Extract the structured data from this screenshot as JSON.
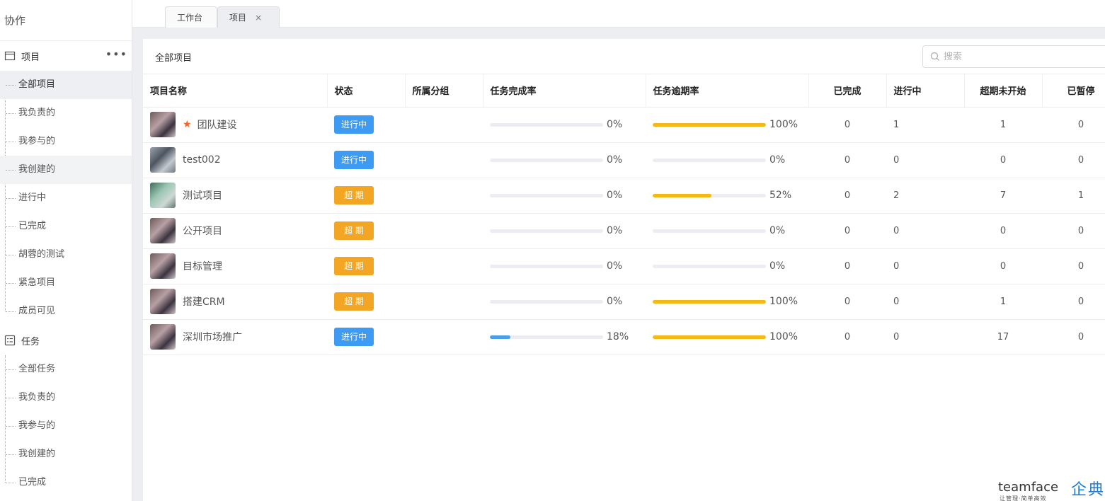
{
  "sidebar": {
    "title": "协作",
    "project_section": {
      "label": "项目",
      "more": "•••",
      "items": [
        "全部项目",
        "我负责的",
        "我参与的",
        "我创建的",
        "进行中",
        "已完成",
        "胡蓉的测试",
        "紧急项目",
        "成员可见"
      ]
    },
    "task_section": {
      "label": "任务",
      "items": [
        "全部任务",
        "我负责的",
        "我参与的",
        "我创建的",
        "已完成"
      ]
    }
  },
  "tabs": [
    {
      "label": "工作台"
    },
    {
      "label": "项目",
      "close": "×"
    }
  ],
  "panel": {
    "title": "全部项目",
    "search_placeholder": "搜索"
  },
  "table": {
    "headers": [
      "项目名称",
      "状态",
      "所属分组",
      "任务完成率",
      "任务逾期率",
      "已完成",
      "进行中",
      "超期未开始",
      "已暂停"
    ],
    "rows": [
      {
        "name": "团队建设",
        "starred": true,
        "status": "进行中",
        "status_color": "#3d9bf4",
        "group": "",
        "completion": 0,
        "completion_text": "0%",
        "overdue": 100,
        "overdue_text": "100%",
        "done": "0",
        "ongoing": "1",
        "overdue_not_started": "1",
        "paused": "0"
      },
      {
        "name": "test002",
        "starred": false,
        "status": "进行中",
        "status_color": "#3d9bf4",
        "group": "",
        "completion": 0,
        "completion_text": "0%",
        "overdue": 0,
        "overdue_text": "0%",
        "done": "0",
        "ongoing": "0",
        "overdue_not_started": "0",
        "paused": "0"
      },
      {
        "name": "测试项目",
        "starred": false,
        "status": "超 期",
        "status_color": "#f3a623",
        "group": "",
        "completion": 0,
        "completion_text": "0%",
        "overdue": 52,
        "overdue_text": "52%",
        "done": "0",
        "ongoing": "2",
        "overdue_not_started": "7",
        "paused": "1"
      },
      {
        "name": "公开项目",
        "starred": false,
        "status": "超 期",
        "status_color": "#f3a623",
        "group": "",
        "completion": 0,
        "completion_text": "0%",
        "overdue": 0,
        "overdue_text": "0%",
        "done": "0",
        "ongoing": "0",
        "overdue_not_started": "0",
        "paused": "0"
      },
      {
        "name": "目标管理",
        "starred": false,
        "status": "超 期",
        "status_color": "#f3a623",
        "group": "",
        "completion": 0,
        "completion_text": "0%",
        "overdue": 0,
        "overdue_text": "0%",
        "done": "0",
        "ongoing": "0",
        "overdue_not_started": "0",
        "paused": "0"
      },
      {
        "name": "搭建CRM",
        "starred": false,
        "status": "超 期",
        "status_color": "#f3a623",
        "group": "",
        "completion": 0,
        "completion_text": "0%",
        "overdue": 100,
        "overdue_text": "100%",
        "done": "0",
        "ongoing": "0",
        "overdue_not_started": "1",
        "paused": "0"
      },
      {
        "name": "深圳市场推广",
        "starred": false,
        "status": "进行中",
        "status_color": "#3d9bf4",
        "group": "",
        "completion": 18,
        "completion_text": "18%",
        "overdue": 100,
        "overdue_text": "100%",
        "done": "0",
        "ongoing": "0",
        "overdue_not_started": "17",
        "paused": "0"
      }
    ]
  },
  "watermark": {
    "en": "teamface",
    "sub": "让管理·简单高效",
    "cn": "企典"
  },
  "colors": {
    "accent_blue": "#3d9bf4",
    "overdue_orange": "#f3a623",
    "bar_yellow": "#f5b914",
    "bar_blue": "#4a9ee8",
    "star": "#f26522"
  },
  "icons": {
    "project": "folder-icon",
    "task": "checklist-icon",
    "search": "search-icon",
    "star": "star-icon",
    "close": "close-icon"
  }
}
